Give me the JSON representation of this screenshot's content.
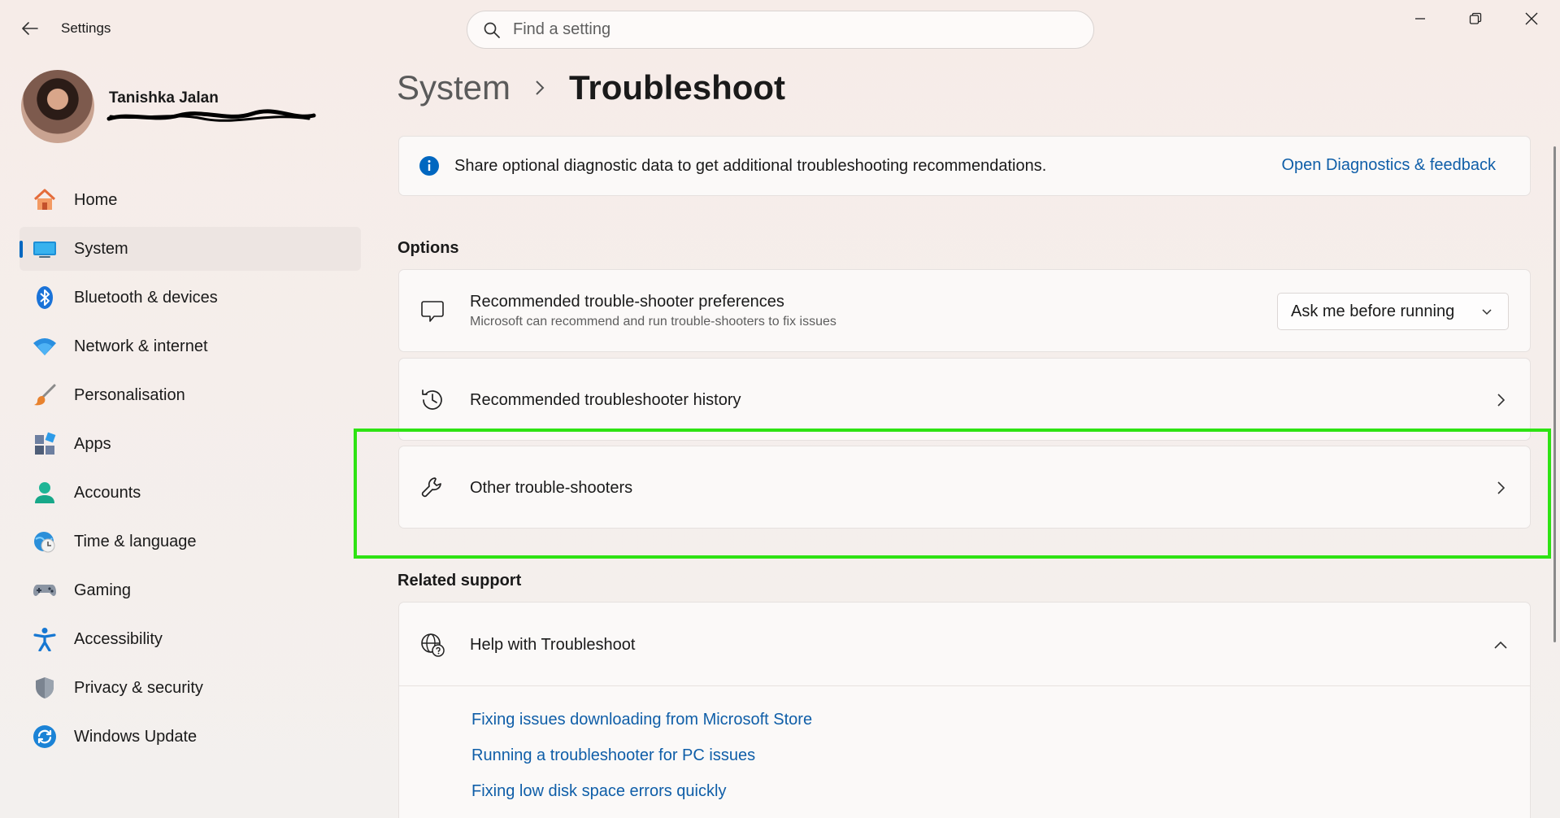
{
  "window": {
    "app_title": "Settings",
    "search_placeholder": "Find a setting"
  },
  "profile": {
    "name": "Tanishka Jalan",
    "email": ""
  },
  "sidebar": {
    "items": [
      {
        "label": "Home",
        "icon": "home-icon"
      },
      {
        "label": "System",
        "icon": "system-icon",
        "active": true
      },
      {
        "label": "Bluetooth & devices",
        "icon": "bluetooth-icon"
      },
      {
        "label": "Network & internet",
        "icon": "wifi-icon"
      },
      {
        "label": "Personalisation",
        "icon": "brush-icon"
      },
      {
        "label": "Apps",
        "icon": "apps-icon"
      },
      {
        "label": "Accounts",
        "icon": "accounts-icon"
      },
      {
        "label": "Time & language",
        "icon": "globe-clock-icon"
      },
      {
        "label": "Gaming",
        "icon": "gamepad-icon"
      },
      {
        "label": "Accessibility",
        "icon": "accessibility-icon"
      },
      {
        "label": "Privacy & security",
        "icon": "shield-icon"
      },
      {
        "label": "Windows Update",
        "icon": "update-icon"
      }
    ]
  },
  "breadcrumb": {
    "parent": "System",
    "current": "Troubleshoot"
  },
  "info_banner": {
    "text": "Share optional diagnostic data to get additional troubleshooting recommendations.",
    "link": "Open Diagnostics & feedback"
  },
  "options": {
    "title": "Options",
    "preferences": {
      "title": "Recommended trouble-shooter preferences",
      "subtitle": "Microsoft can recommend and run trouble-shooters to fix issues",
      "selected": "Ask me before running"
    },
    "history": {
      "title": "Recommended troubleshooter history"
    },
    "other": {
      "title": "Other trouble-shooters"
    }
  },
  "related": {
    "title": "Related support",
    "help_title": "Help with Troubleshoot",
    "links": [
      "Fixing issues downloading from Microsoft Store",
      "Running a troubleshooter for PC issues",
      "Fixing low disk space errors quickly"
    ]
  },
  "colors": {
    "accent": "#0067c0",
    "link": "#0f5ea8",
    "highlight": "#2ee313"
  }
}
